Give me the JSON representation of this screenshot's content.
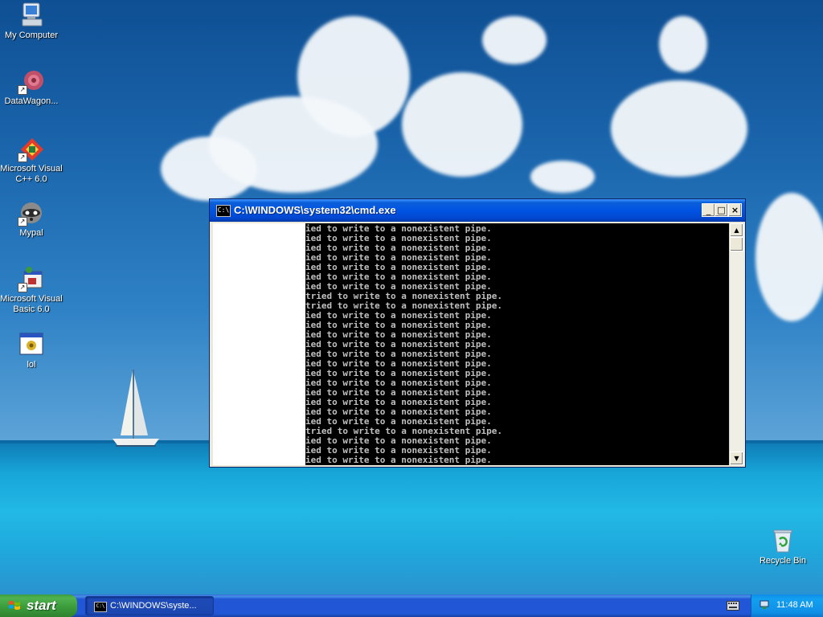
{
  "desktop": {
    "icons": [
      {
        "label": "My Computer",
        "icon": "my-computer-icon"
      },
      {
        "label": "DataWagon...",
        "icon": "datawagon-icon"
      },
      {
        "label": "Microsoft Visual C++ 6.0",
        "icon": "visual-cpp-icon"
      },
      {
        "label": "Mypal",
        "icon": "mypal-raccoon-icon"
      },
      {
        "label": "Microsoft Visual Basic 6.0",
        "icon": "visual-basic-icon"
      },
      {
        "label": "lol",
        "icon": "application-window-icon"
      },
      {
        "label": "Recycle Bin",
        "icon": "recycle-bin-icon"
      }
    ]
  },
  "window": {
    "title": "C:\\WINDOWS\\system32\\cmd.exe",
    "minimize": "_",
    "maximize": "□",
    "close": "×",
    "console_lines": [
      "ied to write to a nonexistent pipe.",
      "ied to write to a nonexistent pipe.",
      "ied to write to a nonexistent pipe.",
      "ied to write to a nonexistent pipe.",
      "ied to write to a nonexistent pipe.",
      "ied to write to a nonexistent pipe.",
      "ied to write to a nonexistent pipe.",
      "tried to write to a nonexistent pipe.",
      "tried to write to a nonexistent pipe.",
      "ied to write to a nonexistent pipe.",
      "ied to write to a nonexistent pipe.",
      "ied to write to a nonexistent pipe.",
      "ied to write to a nonexistent pipe.",
      "ied to write to a nonexistent pipe.",
      "ied to write to a nonexistent pipe.",
      "ied to write to a nonexistent pipe.",
      "ied to write to a nonexistent pipe.",
      "ied to write to a nonexistent pipe.",
      "ied to write to a nonexistent pipe.",
      "ied to write to a nonexistent pipe.",
      "ied to write to a nonexistent pipe.",
      "tried to write to a nonexistent pipe.",
      "ied to write to a nonexistent pipe.",
      "ied to write to a nonexistent pipe.",
      "ied to write to a nonexistent pipe."
    ],
    "scroll_up": "▲",
    "scroll_down": "▼"
  },
  "taskbar": {
    "start_label": "start",
    "task_label": "C:\\WINDOWS\\syste...",
    "clock": "11:48 AM"
  }
}
